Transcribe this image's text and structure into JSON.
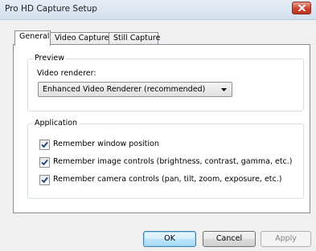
{
  "window": {
    "title": "Pro HD Capture Setup"
  },
  "tabs": [
    {
      "label": "General",
      "active": true
    },
    {
      "label": "Video Capture",
      "active": false
    },
    {
      "label": "Still Capture",
      "active": false
    }
  ],
  "preview": {
    "group_title": "Preview",
    "renderer_label": "Video renderer:",
    "renderer_value": "Enhanced Video Renderer (recommended)"
  },
  "application": {
    "group_title": "Application",
    "options": [
      {
        "label": "Remember window position",
        "checked": true
      },
      {
        "label": "Remember image controls (brightness, contrast, gamma, etc.)",
        "checked": true
      },
      {
        "label": "Remember camera controls (pan, tilt, zoom, exposure, etc.)",
        "checked": true
      }
    ]
  },
  "buttons": {
    "ok": "OK",
    "cancel": "Cancel",
    "apply": "Apply"
  },
  "icons": {
    "close": "close-icon",
    "dropdown": "chevron-down-icon",
    "check": "checkmark-icon"
  },
  "colors": {
    "close_button": "#c9452e",
    "default_button_border": "#3c7fb1",
    "disabled_text": "#838383"
  }
}
